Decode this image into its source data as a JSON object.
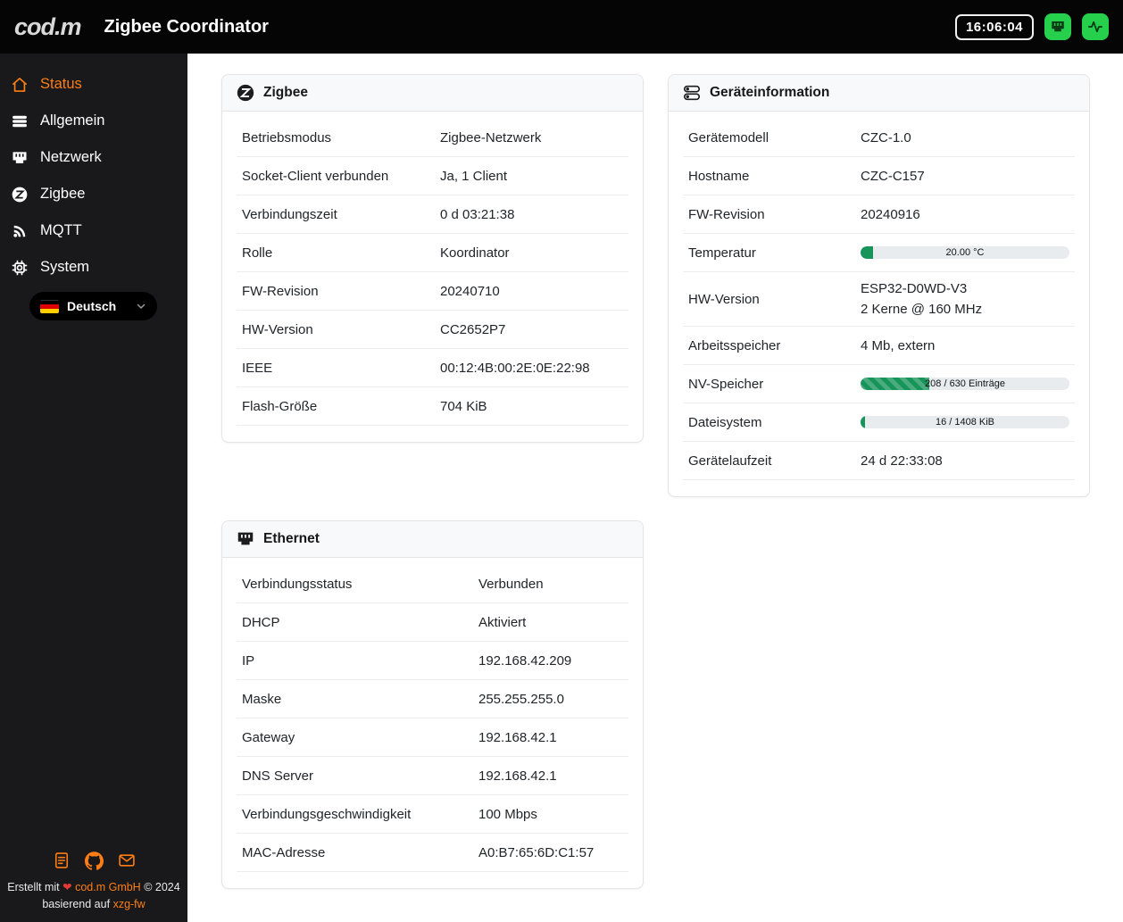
{
  "colors": {
    "accent": "#fd7e14",
    "success": "#17945a",
    "indicator": "#27d04c"
  },
  "header": {
    "logo": "cod.m",
    "title": "Zigbee Coordinator",
    "time": "16:06:04"
  },
  "sidebar": {
    "items": [
      {
        "label": "Status",
        "icon": "home",
        "active": true
      },
      {
        "label": "Allgemein",
        "icon": "list"
      },
      {
        "label": "Netzwerk",
        "icon": "ethernet"
      },
      {
        "label": "Zigbee",
        "icon": "zigbee"
      },
      {
        "label": "MQTT",
        "icon": "broadcast"
      },
      {
        "label": "System",
        "icon": "chip"
      }
    ],
    "language": {
      "label": "Deutsch",
      "flag": "de"
    },
    "footer": {
      "made_with": "Erstellt mit",
      "heart": "❤",
      "company": "cod.m GmbH",
      "copyright": "© 2024",
      "based_on": "basierend auf",
      "firmware": "xzg-fw"
    }
  },
  "cards": {
    "zigbee": {
      "title": "Zigbee",
      "rows": [
        {
          "label": "Betriebsmodus",
          "value": "Zigbee-Netzwerk"
        },
        {
          "label": "Socket-Client verbunden",
          "value": "Ja, 1 Client"
        },
        {
          "label": "Verbindungszeit",
          "value": "0 d 03:21:38"
        },
        {
          "label": "Rolle",
          "value": "Koordinator"
        },
        {
          "label": "FW-Revision",
          "value": "20240710"
        },
        {
          "label": "HW-Version",
          "value": "CC2652P7"
        },
        {
          "label": "IEEE",
          "value": "00:12:4B:00:2E:0E:22:98"
        },
        {
          "label": "Flash-Größe",
          "value": "704 KiB"
        }
      ]
    },
    "device": {
      "title": "Geräteinformation",
      "rows": [
        {
          "label": "Gerätemodell",
          "value": "CZC-1.0"
        },
        {
          "label": "Hostname",
          "value": "CZC-C157"
        },
        {
          "label": "FW-Revision",
          "value": "20240916"
        },
        {
          "label": "Temperatur",
          "type": "progress",
          "text": "20.00 °C",
          "percent": 6,
          "striped": false
        },
        {
          "label": "HW-Version",
          "value": "ESP32-D0WD-V3\n2 Kerne @ 160 MHz"
        },
        {
          "label": "Arbeitsspeicher",
          "value": "4 Mb, extern"
        },
        {
          "label": "NV-Speicher",
          "type": "progress",
          "text": "208 / 630 Einträge",
          "percent": 33,
          "striped": true
        },
        {
          "label": "Dateisystem",
          "type": "progress",
          "text": "16 / 1408 KiB",
          "percent": 2,
          "striped": false
        },
        {
          "label": "Gerätelaufzeit",
          "value": "24 d 22:33:08"
        }
      ]
    },
    "ethernet": {
      "title": "Ethernet",
      "rows": [
        {
          "label": "Verbindungsstatus",
          "value": "Verbunden"
        },
        {
          "label": "DHCP",
          "value": "Aktiviert"
        },
        {
          "label": "IP",
          "value": "192.168.42.209"
        },
        {
          "label": "Maske",
          "value": "255.255.255.0"
        },
        {
          "label": "Gateway",
          "value": "192.168.42.1"
        },
        {
          "label": "DNS Server",
          "value": "192.168.42.1"
        },
        {
          "label": "Verbindungsgeschwindigkeit",
          "value": "100 Mbps"
        },
        {
          "label": "MAC-Adresse",
          "value": "A0:B7:65:6D:C1:57"
        }
      ]
    }
  }
}
